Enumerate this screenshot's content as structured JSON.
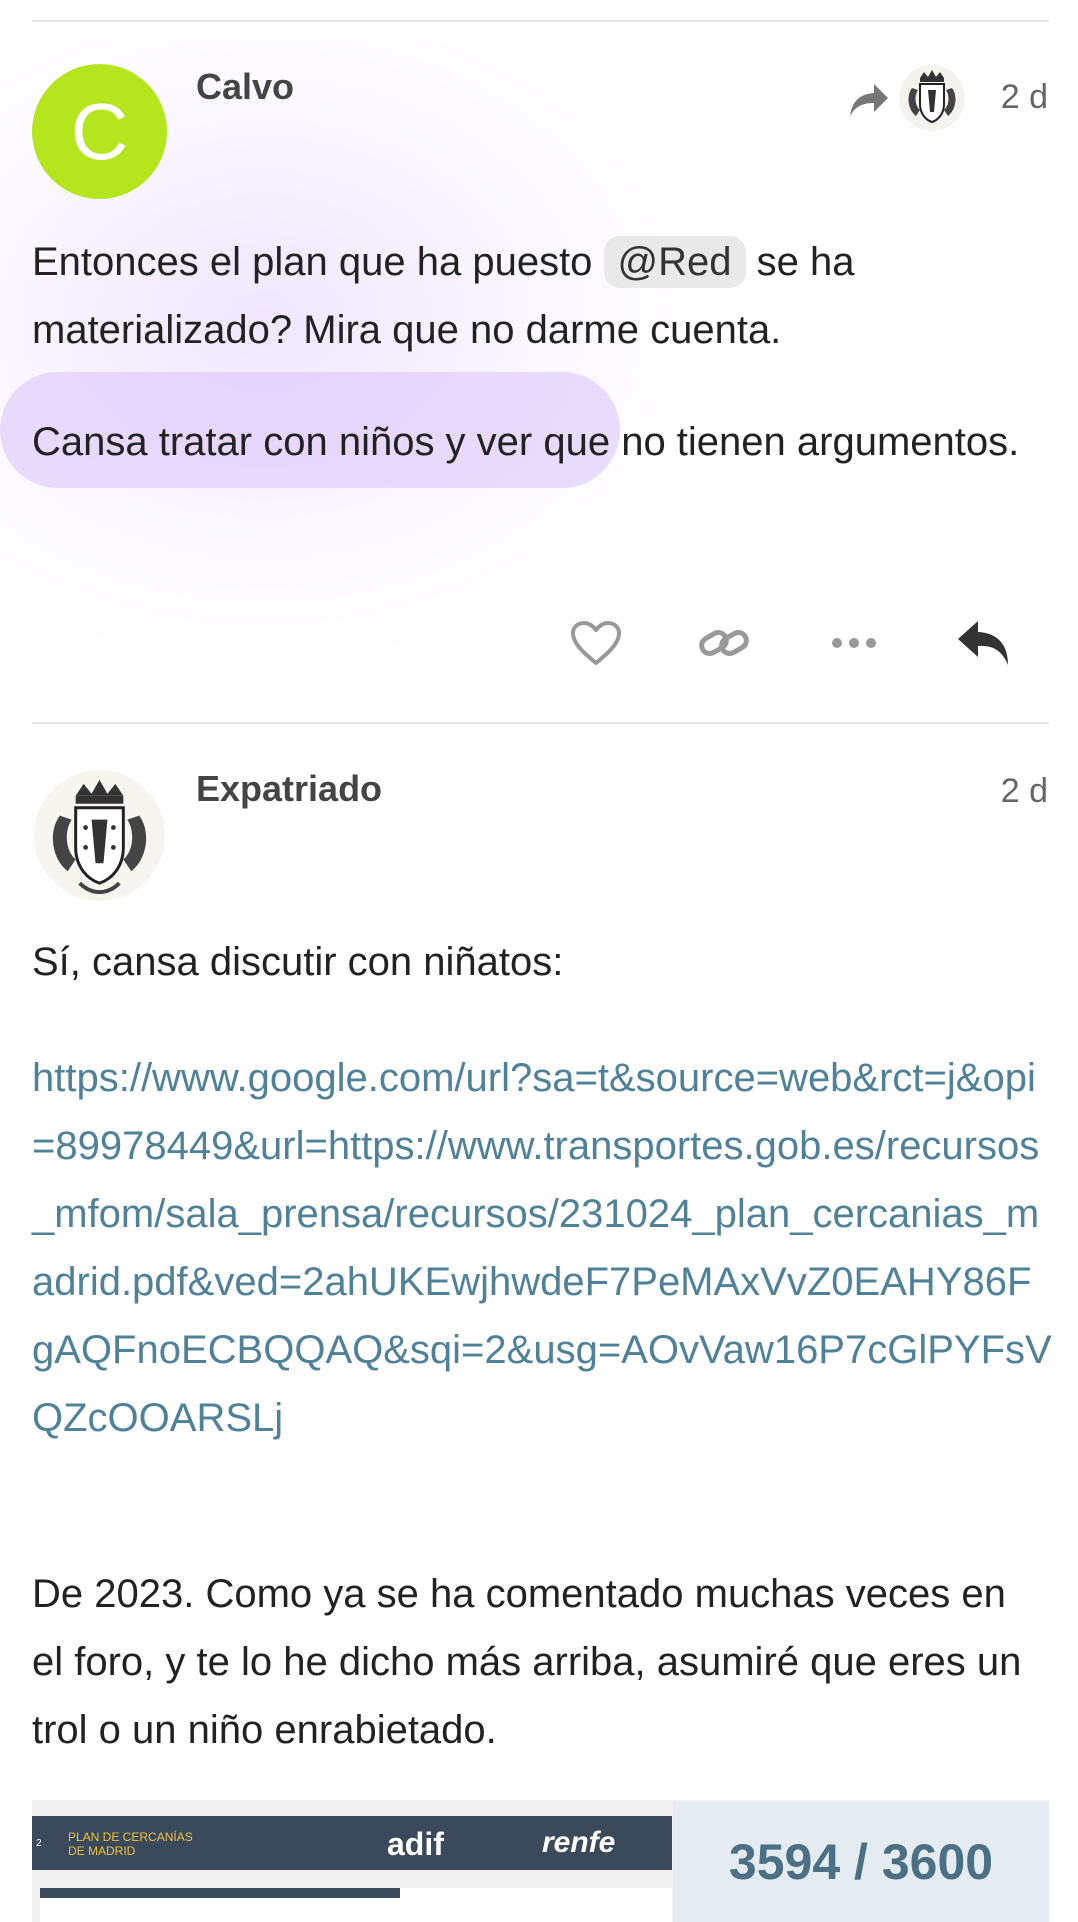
{
  "posts": [
    {
      "username": "Calvo",
      "avatar_letter": "C",
      "avatar_color": "#b5e61d",
      "date": "2 d",
      "reply_icon": "share-arrow-icon",
      "text_before_mention": "Entonces el plan que ha puesto ",
      "mention": "@Red",
      "text_after_mention": " se ha materializado? Mira que no darme cuenta.",
      "paragraph2": "Cansa tratar con niños y ver que no tienen argumentos.",
      "actions": [
        "heart-icon",
        "link-icon",
        "more-icon",
        "reply-icon"
      ]
    },
    {
      "username": "Expatriado",
      "date": "2 d",
      "paragraph1": "Sí, cansa discutir con niñatos:",
      "link": "https://www.google.com/url?sa=t&source=web&rct=j&opi=89978449&url=https://www.transportes.gob.es/recursos_mfom/sala_prensa/recursos/231024_plan_cercanias_madrid.pdf&ved=2ahUKEwjhwdeF7PeMAxVvZ0EAHY86FgAQFnoECBQQAQ&sqi=2&usg=AOvVaw16P7cGlPYFsVQZcOOARSLj",
      "paragraph3": "De 2023. Como ya se ha comentado muchas veces en el foro, y te lo he dicho más arriba, asumiré que eres un trol o un niño enrabietado.",
      "embed": {
        "page_number": "2",
        "title_line1": "PLAN DE CERCANÍAS",
        "title_line2": "DE MADRID",
        "brand1": "adif",
        "brand2": "renfe"
      }
    }
  ],
  "counter": "3594 / 3600",
  "colors": {
    "link": "#4f8199",
    "counter_bg": "#e4ecf1",
    "counter_text": "#4b6f85"
  }
}
